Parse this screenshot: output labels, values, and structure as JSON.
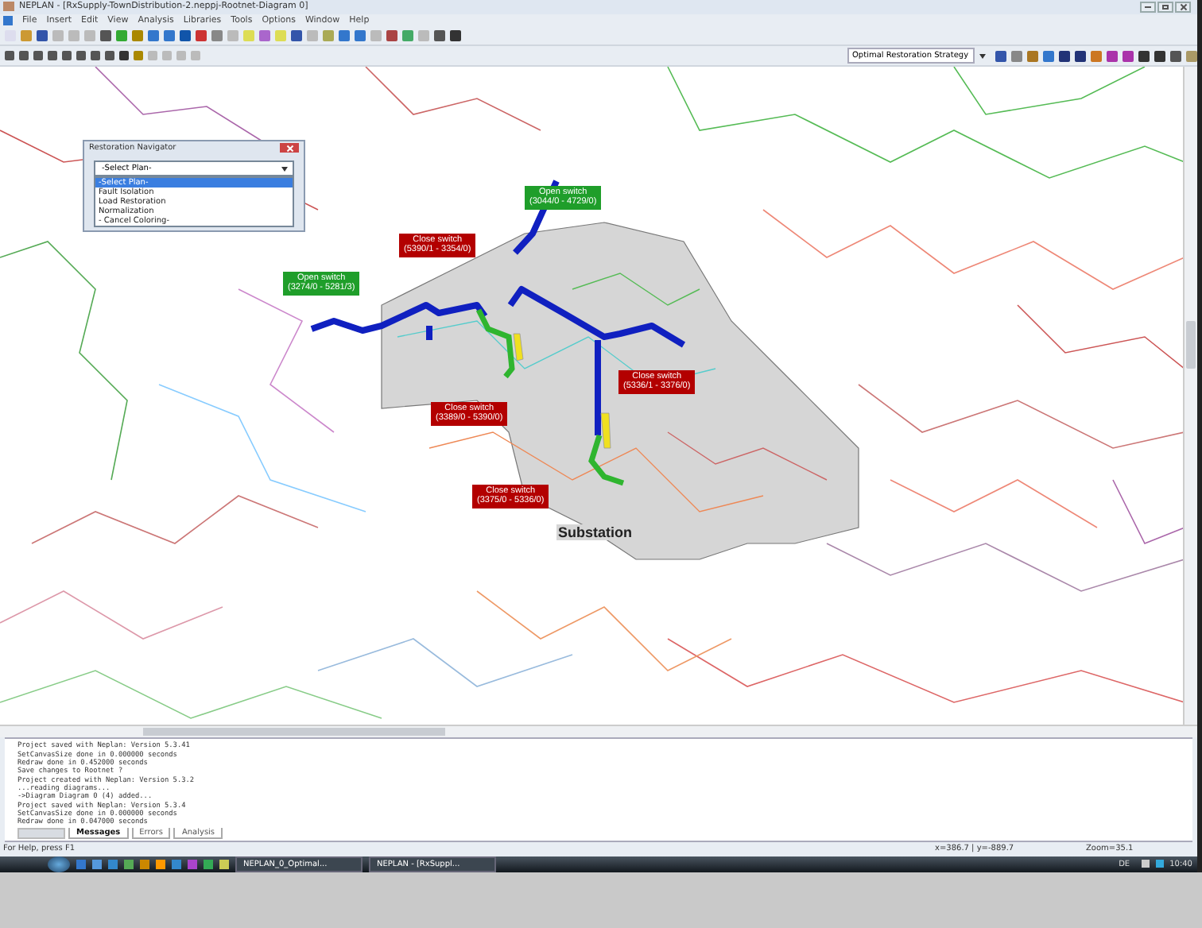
{
  "window": {
    "title": "NEPLAN - [RxSupply-TownDistribution-2.neppj-Rootnet-Diagram 0]"
  },
  "menu": [
    "File",
    "Insert",
    "Edit",
    "View",
    "Analysis",
    "Libraries",
    "Tools",
    "Options",
    "Window",
    "Help"
  ],
  "toolbar": {
    "strategy": "Optimal Restoration Strategy"
  },
  "navigator": {
    "title": "Restoration Navigator",
    "value": "-Select Plan-",
    "options": [
      {
        "label": "-Select Plan-",
        "selected": true
      },
      {
        "label": "Fault Isolation",
        "selected": false
      },
      {
        "label": "Load Restoration",
        "selected": false
      },
      {
        "label": "Normalization",
        "selected": false
      },
      {
        "label": "- Cancel Coloring-",
        "selected": false
      }
    ]
  },
  "map": {
    "callouts": [
      {
        "kind": "open",
        "title": "Open switch",
        "ids": "(3044/0 - 4729/0)"
      },
      {
        "kind": "close",
        "title": "Close switch",
        "ids": "(5390/1 - 3354/0)"
      },
      {
        "kind": "open",
        "title": "Open switch",
        "ids": "(3274/0 - 5281/3)"
      },
      {
        "kind": "close",
        "title": "Close switch",
        "ids": "(5336/1 - 3376/0)"
      },
      {
        "kind": "close",
        "title": "Close switch",
        "ids": "(3389/0 - 5390/0)"
      },
      {
        "kind": "close",
        "title": "Close switch",
        "ids": "(3375/0 - 5336/0)"
      }
    ],
    "substation": "Substation"
  },
  "messages": [
    "Project saved with Neplan: Version 5.3.41",
    "SetCanvasSize done in 0.000000 seconds",
    "Redraw done in 0.452000 seconds",
    "Save changes to Rootnet ?",
    "Project created with Neplan: Version 5.3.2",
    "...reading diagrams...",
    "->Diagram Diagram 0 (4) added...",
    "Project saved with Neplan: Version 5.3.4",
    "SetCanvasSize done in 0.000000 seconds",
    "Redraw done in 0.047000 seconds"
  ],
  "message_tabs": [
    {
      "label": "Messages",
      "selected": true
    },
    {
      "label": "Errors",
      "selected": false
    },
    {
      "label": "Analysis",
      "selected": false
    }
  ],
  "status_bar": {
    "help": "For Help, press F1",
    "coords": "x=386.7 | y=-889.7",
    "zoom": "Zoom=35.1"
  },
  "taskbar": {
    "tasks": [
      {
        "label": "NEPLAN_0_Optimal..."
      },
      {
        "label": "NEPLAN - [RxSuppl..."
      }
    ],
    "language": "DE",
    "time": "10:40"
  }
}
